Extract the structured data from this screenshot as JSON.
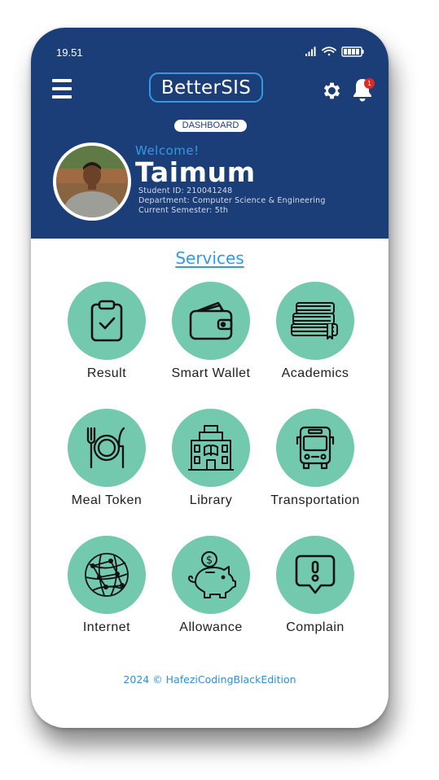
{
  "status_bar": {
    "time": "19.51",
    "icons": [
      "signal-icon",
      "wifi-icon",
      "battery-icon"
    ]
  },
  "header": {
    "brand": "BetterSIS",
    "section_badge": "DASHBOARD",
    "notification_count": "1",
    "background_color": "#1c3e78",
    "accent_color": "#2f9be3"
  },
  "profile": {
    "welcome": "Welcome!",
    "name": "Taimum",
    "student_id": "Student ID: 210041248",
    "department": "Department: Computer Science & Engineering",
    "semester": "Current Semester: 5th"
  },
  "services": {
    "title": "Services",
    "tile_color": "#72c9ad",
    "items": [
      {
        "label": "Result",
        "icon": "clipboard-check-icon"
      },
      {
        "label": "Smart Wallet",
        "icon": "wallet-icon"
      },
      {
        "label": "Academics",
        "icon": "books-icon"
      },
      {
        "label": "Meal Token",
        "icon": "plate-cutlery-icon"
      },
      {
        "label": "Library",
        "icon": "library-building-icon"
      },
      {
        "label": "Transportation",
        "icon": "bus-icon"
      },
      {
        "label": "Internet",
        "icon": "globe-network-icon"
      },
      {
        "label": "Allowance",
        "icon": "piggy-bank-icon"
      },
      {
        "label": "Complain",
        "icon": "complaint-bubble-icon"
      }
    ]
  },
  "footer": {
    "text": "2024 © HafeziCodingBlackEdition"
  }
}
